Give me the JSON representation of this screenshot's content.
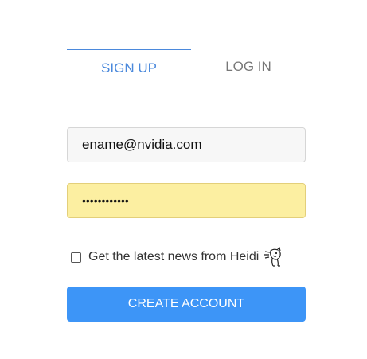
{
  "tabs": {
    "signup_label": "SIGN UP",
    "login_label": "LOG IN",
    "active": "signup"
  },
  "form": {
    "email_value": "ename@nvidia.com",
    "password_value": "••••••••••••",
    "newsletter_label": "Get the latest news from Heidi",
    "newsletter_checked": false,
    "mascot_icon": "heidi-mascot-icon",
    "submit_label": "CREATE ACCOUNT"
  },
  "colors": {
    "accent": "#4b89dc",
    "button": "#3d95f7",
    "autofill": "#fcefa1",
    "inactive_tab": "#777777"
  }
}
